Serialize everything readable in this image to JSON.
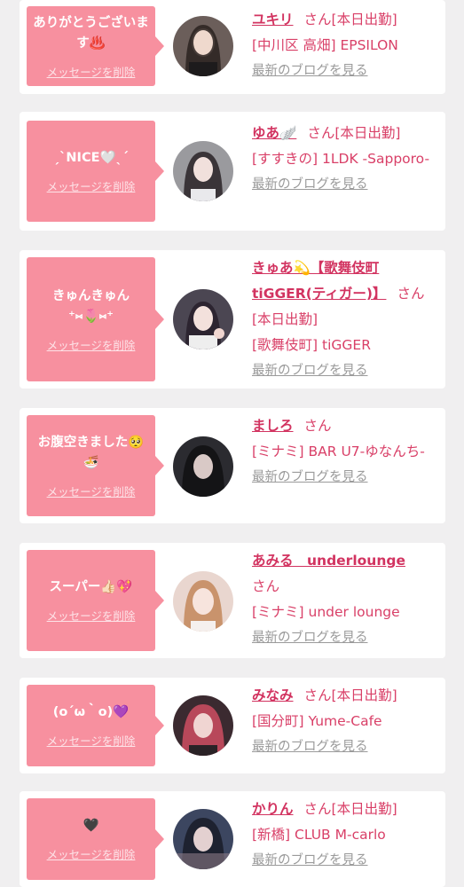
{
  "delete_label": "メッセージを削除",
  "blog_label": "最新のブログを見る",
  "cards": [
    {
      "message": "ありがとうございます♨️",
      "name": "ユキリ",
      "honorific": "さん[本日出勤]",
      "shop": "[中川区 高畑] EPSILON"
    },
    {
      "message": "ˏˋNICE🤍ˎˊ",
      "name": "ゆあ🪽",
      "honorific": "さん[本日出勤]",
      "shop": "[すすきの] 1LDK -Sapporo-"
    },
    {
      "message": "きゅんきゅん⁺⑅🌷⑅⁺",
      "name": "きゅあ💫【歌舞伎町tiGGER(ティガー)】",
      "honorific": "さん[本日出勤]",
      "shop": "[歌舞伎町] tiGGER"
    },
    {
      "message": "お腹空きました🥺🍜",
      "name": "ましろ",
      "honorific": "さん",
      "shop": "[ミナミ] BAR U7-ゆなんち-"
    },
    {
      "message": "スーパー👍🏻💖",
      "name": "あみる　underlounge",
      "honorific": "さん",
      "shop": "[ミナミ] under lounge"
    },
    {
      "message": "(o´ω｀o)💜",
      "name": "みなみ",
      "honorific": "さん[本日出勤]",
      "shop": "[国分町] Yume-Cafe"
    },
    {
      "message": "🖤",
      "name": "かりん",
      "honorific": "さん[本日出勤]",
      "shop": "[新橋] CLUB M-carlo"
    }
  ],
  "colors": {
    "bubble": "#f7909f",
    "name": "#d23360",
    "text": "#d94068",
    "link_gray": "#9a9a9a",
    "background": "#f0eff0"
  }
}
